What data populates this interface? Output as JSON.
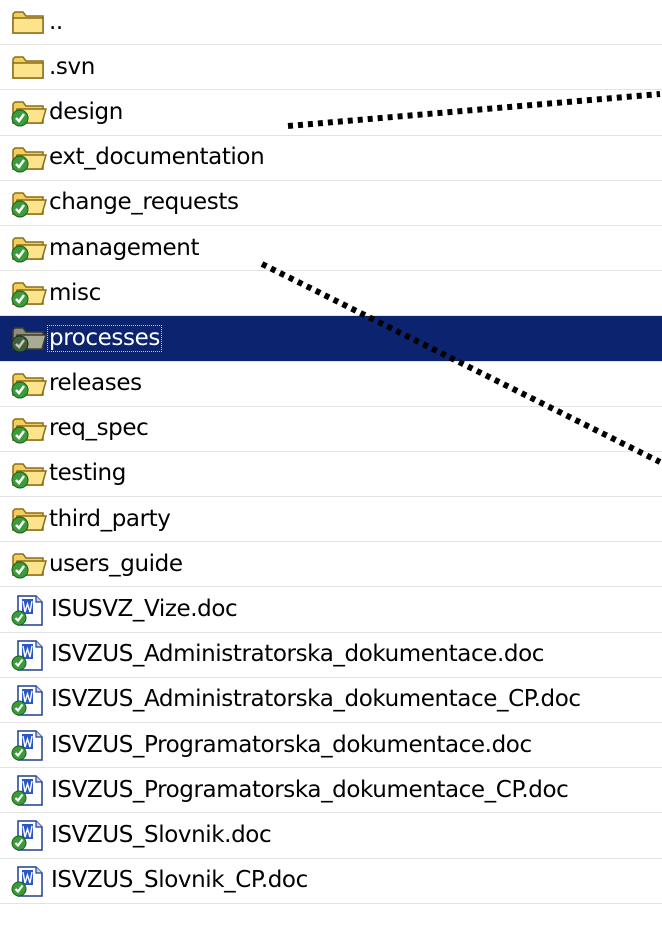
{
  "items": [
    {
      "label": "..",
      "icon": "folder-icon",
      "kind": "folder",
      "selected": false
    },
    {
      "label": ".svn",
      "icon": "folder-icon",
      "kind": "folder",
      "selected": false
    },
    {
      "label": "design",
      "icon": "svn-folder-icon",
      "kind": "svn-folder",
      "selected": false
    },
    {
      "label": "ext_documentation",
      "icon": "svn-folder-icon",
      "kind": "svn-folder",
      "selected": false
    },
    {
      "label": "change_requests",
      "icon": "svn-folder-icon",
      "kind": "svn-folder",
      "selected": false
    },
    {
      "label": "management",
      "icon": "svn-folder-icon",
      "kind": "svn-folder",
      "selected": false
    },
    {
      "label": "misc",
      "icon": "svn-folder-icon",
      "kind": "svn-folder",
      "selected": false
    },
    {
      "label": "processes",
      "icon": "svn-folder-icon",
      "kind": "svn-folder",
      "selected": true
    },
    {
      "label": "releases",
      "icon": "svn-folder-icon",
      "kind": "svn-folder",
      "selected": false
    },
    {
      "label": "req_spec",
      "icon": "svn-folder-icon",
      "kind": "svn-folder",
      "selected": false
    },
    {
      "label": "testing",
      "icon": "svn-folder-icon",
      "kind": "svn-folder",
      "selected": false
    },
    {
      "label": "third_party",
      "icon": "svn-folder-icon",
      "kind": "svn-folder",
      "selected": false
    },
    {
      "label": "users_guide",
      "icon": "svn-folder-icon",
      "kind": "svn-folder",
      "selected": false
    },
    {
      "label": "ISUSVZ_Vize.doc",
      "icon": "svn-word-doc-icon",
      "kind": "doc",
      "selected": false
    },
    {
      "label": "ISVZUS_Administratorska_dokumentace.doc",
      "icon": "svn-word-doc-icon",
      "kind": "doc",
      "selected": false
    },
    {
      "label": "ISVZUS_Administratorska_dokumentace_CP.doc",
      "icon": "svn-word-doc-icon",
      "kind": "doc",
      "selected": false
    },
    {
      "label": "ISVZUS_Programatorska_dokumentace.doc",
      "icon": "svn-word-doc-icon",
      "kind": "doc",
      "selected": false
    },
    {
      "label": "ISVZUS_Programatorska_dokumentace_CP.doc",
      "icon": "svn-word-doc-icon",
      "kind": "doc",
      "selected": false
    },
    {
      "label": "ISVZUS_Slovnik.doc",
      "icon": "svn-word-doc-icon",
      "kind": "doc",
      "selected": false
    },
    {
      "label": "ISVZUS_Slovnik_CP.doc",
      "icon": "svn-word-doc-icon",
      "kind": "doc",
      "selected": false
    }
  ],
  "colors": {
    "selection": "#0c2470",
    "folder": "#f4d35e",
    "svn_check": "#2f8f2f",
    "annotation": "#000000"
  }
}
